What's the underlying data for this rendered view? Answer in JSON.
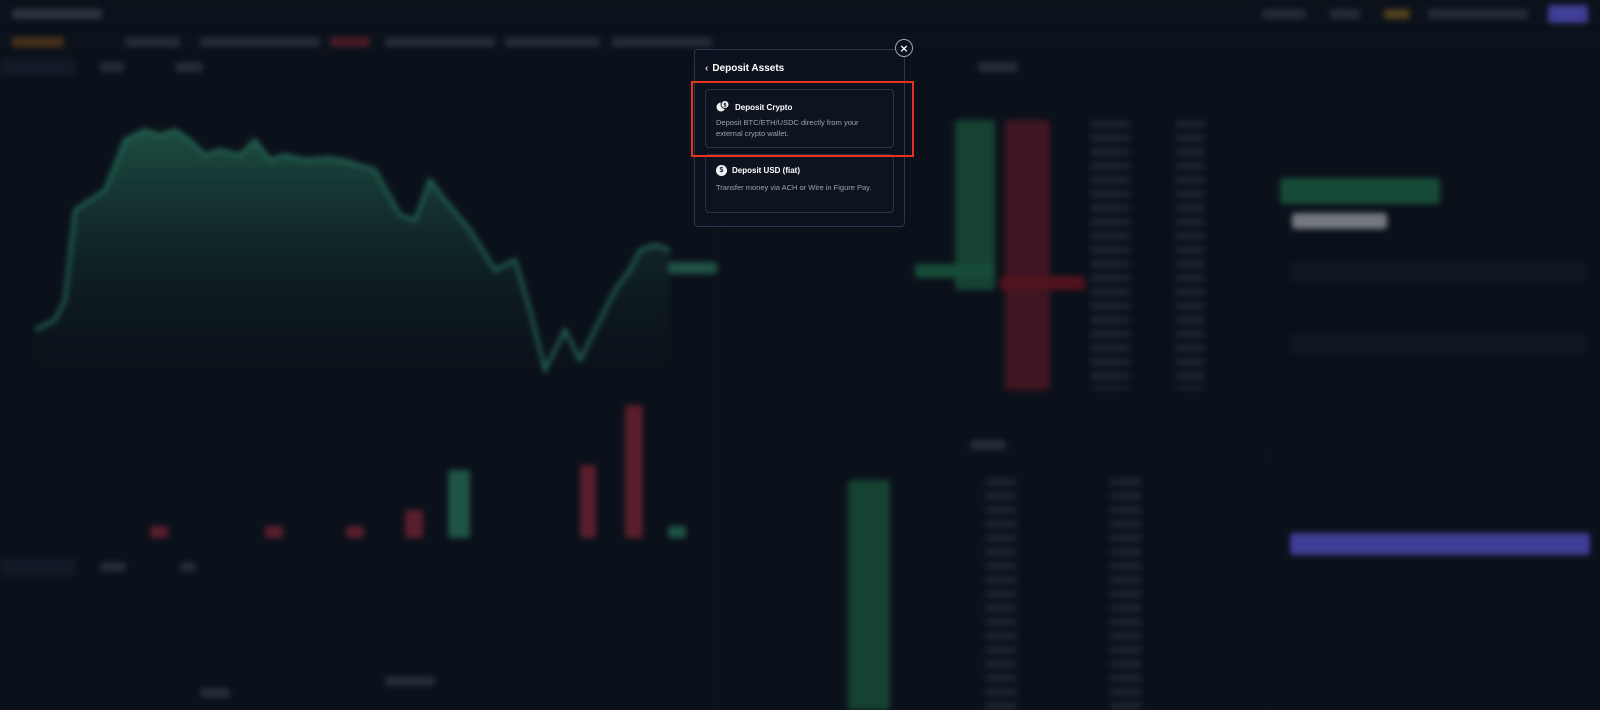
{
  "modal": {
    "title": "Deposit Assets",
    "close_symbol": "×",
    "back_symbol": "‹",
    "options": [
      {
        "title": "Deposit Crypto",
        "description": "Deposit BTC/ETH/USDC directly from your external crypto wallet.",
        "icon": "coins-icon"
      },
      {
        "title": "Deposit USD (fiat)",
        "description": "Transfer money via ACH or Wire in Figure Pay.",
        "icon": "dollar-icon"
      }
    ]
  },
  "colors": {
    "highlight": "#e5321f",
    "accent": "#6c63ff",
    "buy": "#1f7a4f",
    "sell": "#8a2030"
  }
}
